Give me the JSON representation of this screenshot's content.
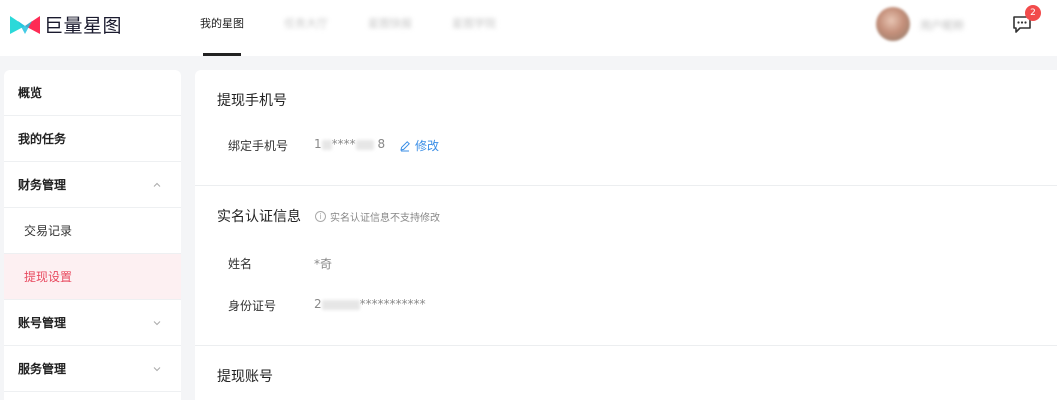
{
  "header": {
    "brand": "巨量星图",
    "nav": [
      "我的星图",
      "任务大厅",
      "星图快报",
      "星图学院"
    ],
    "user_name": "用户昵称",
    "message_count": "2"
  },
  "sidebar": {
    "items": [
      {
        "label": "概览",
        "type": "top"
      },
      {
        "label": "我的任务",
        "type": "top"
      },
      {
        "label": "财务管理",
        "type": "group",
        "expanded": true
      },
      {
        "label": "交易记录",
        "type": "sub"
      },
      {
        "label": "提现设置",
        "type": "sub",
        "active": true
      },
      {
        "label": "账号管理",
        "type": "group",
        "expanded": false
      },
      {
        "label": "服务管理",
        "type": "group",
        "expanded": false
      }
    ]
  },
  "phone": {
    "title": "提现手机号",
    "label": "绑定手机号",
    "value_start": "1",
    "value_mask": "****",
    "value_end": "8",
    "edit": "修改"
  },
  "identity": {
    "title": "实名认证信息",
    "hint": "实名认证信息不支持修改",
    "name_label": "姓名",
    "name_value": "*奇",
    "id_label": "身份证号",
    "id_start": "2",
    "id_mask": "***********"
  },
  "account": {
    "title": "提现账号"
  },
  "colors": {
    "accent": "#e8495f",
    "link": "#3a8ee6",
    "logo_cyan": "#2bd9d9",
    "logo_pink": "#fe2c55"
  }
}
